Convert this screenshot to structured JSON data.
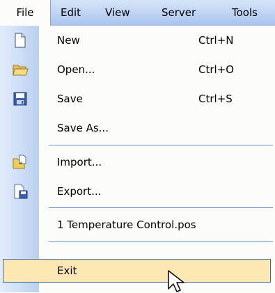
{
  "menubar": {
    "items": [
      "File",
      "Edit",
      "View",
      "Server",
      "Tools"
    ]
  },
  "file_menu": {
    "items": [
      {
        "label": "New",
        "shortcut": "Ctrl+N",
        "icon": "new-document-icon"
      },
      {
        "label": "Open...",
        "shortcut": "Ctrl+O",
        "icon": "open-folder-icon"
      },
      {
        "label": "Save",
        "shortcut": "Ctrl+S",
        "icon": "save-disk-icon"
      },
      {
        "label": "Save As...",
        "shortcut": "",
        "icon": ""
      },
      {
        "label": "Import...",
        "shortcut": "",
        "icon": "import-icon"
      },
      {
        "label": "Export...",
        "shortcut": "",
        "icon": "export-icon"
      },
      {
        "label": "1 Temperature Control.pos",
        "shortcut": "",
        "icon": ""
      },
      {
        "label": "Exit",
        "shortcut": "",
        "icon": ""
      }
    ],
    "highlighted": "Exit"
  },
  "colors": {
    "menubar_top": "#d6e4f8",
    "menubar_bottom": "#a9c3ec",
    "gutter": "#b9d0f0",
    "highlight_fill": "#fde8b4",
    "highlight_border": "#46679a"
  }
}
